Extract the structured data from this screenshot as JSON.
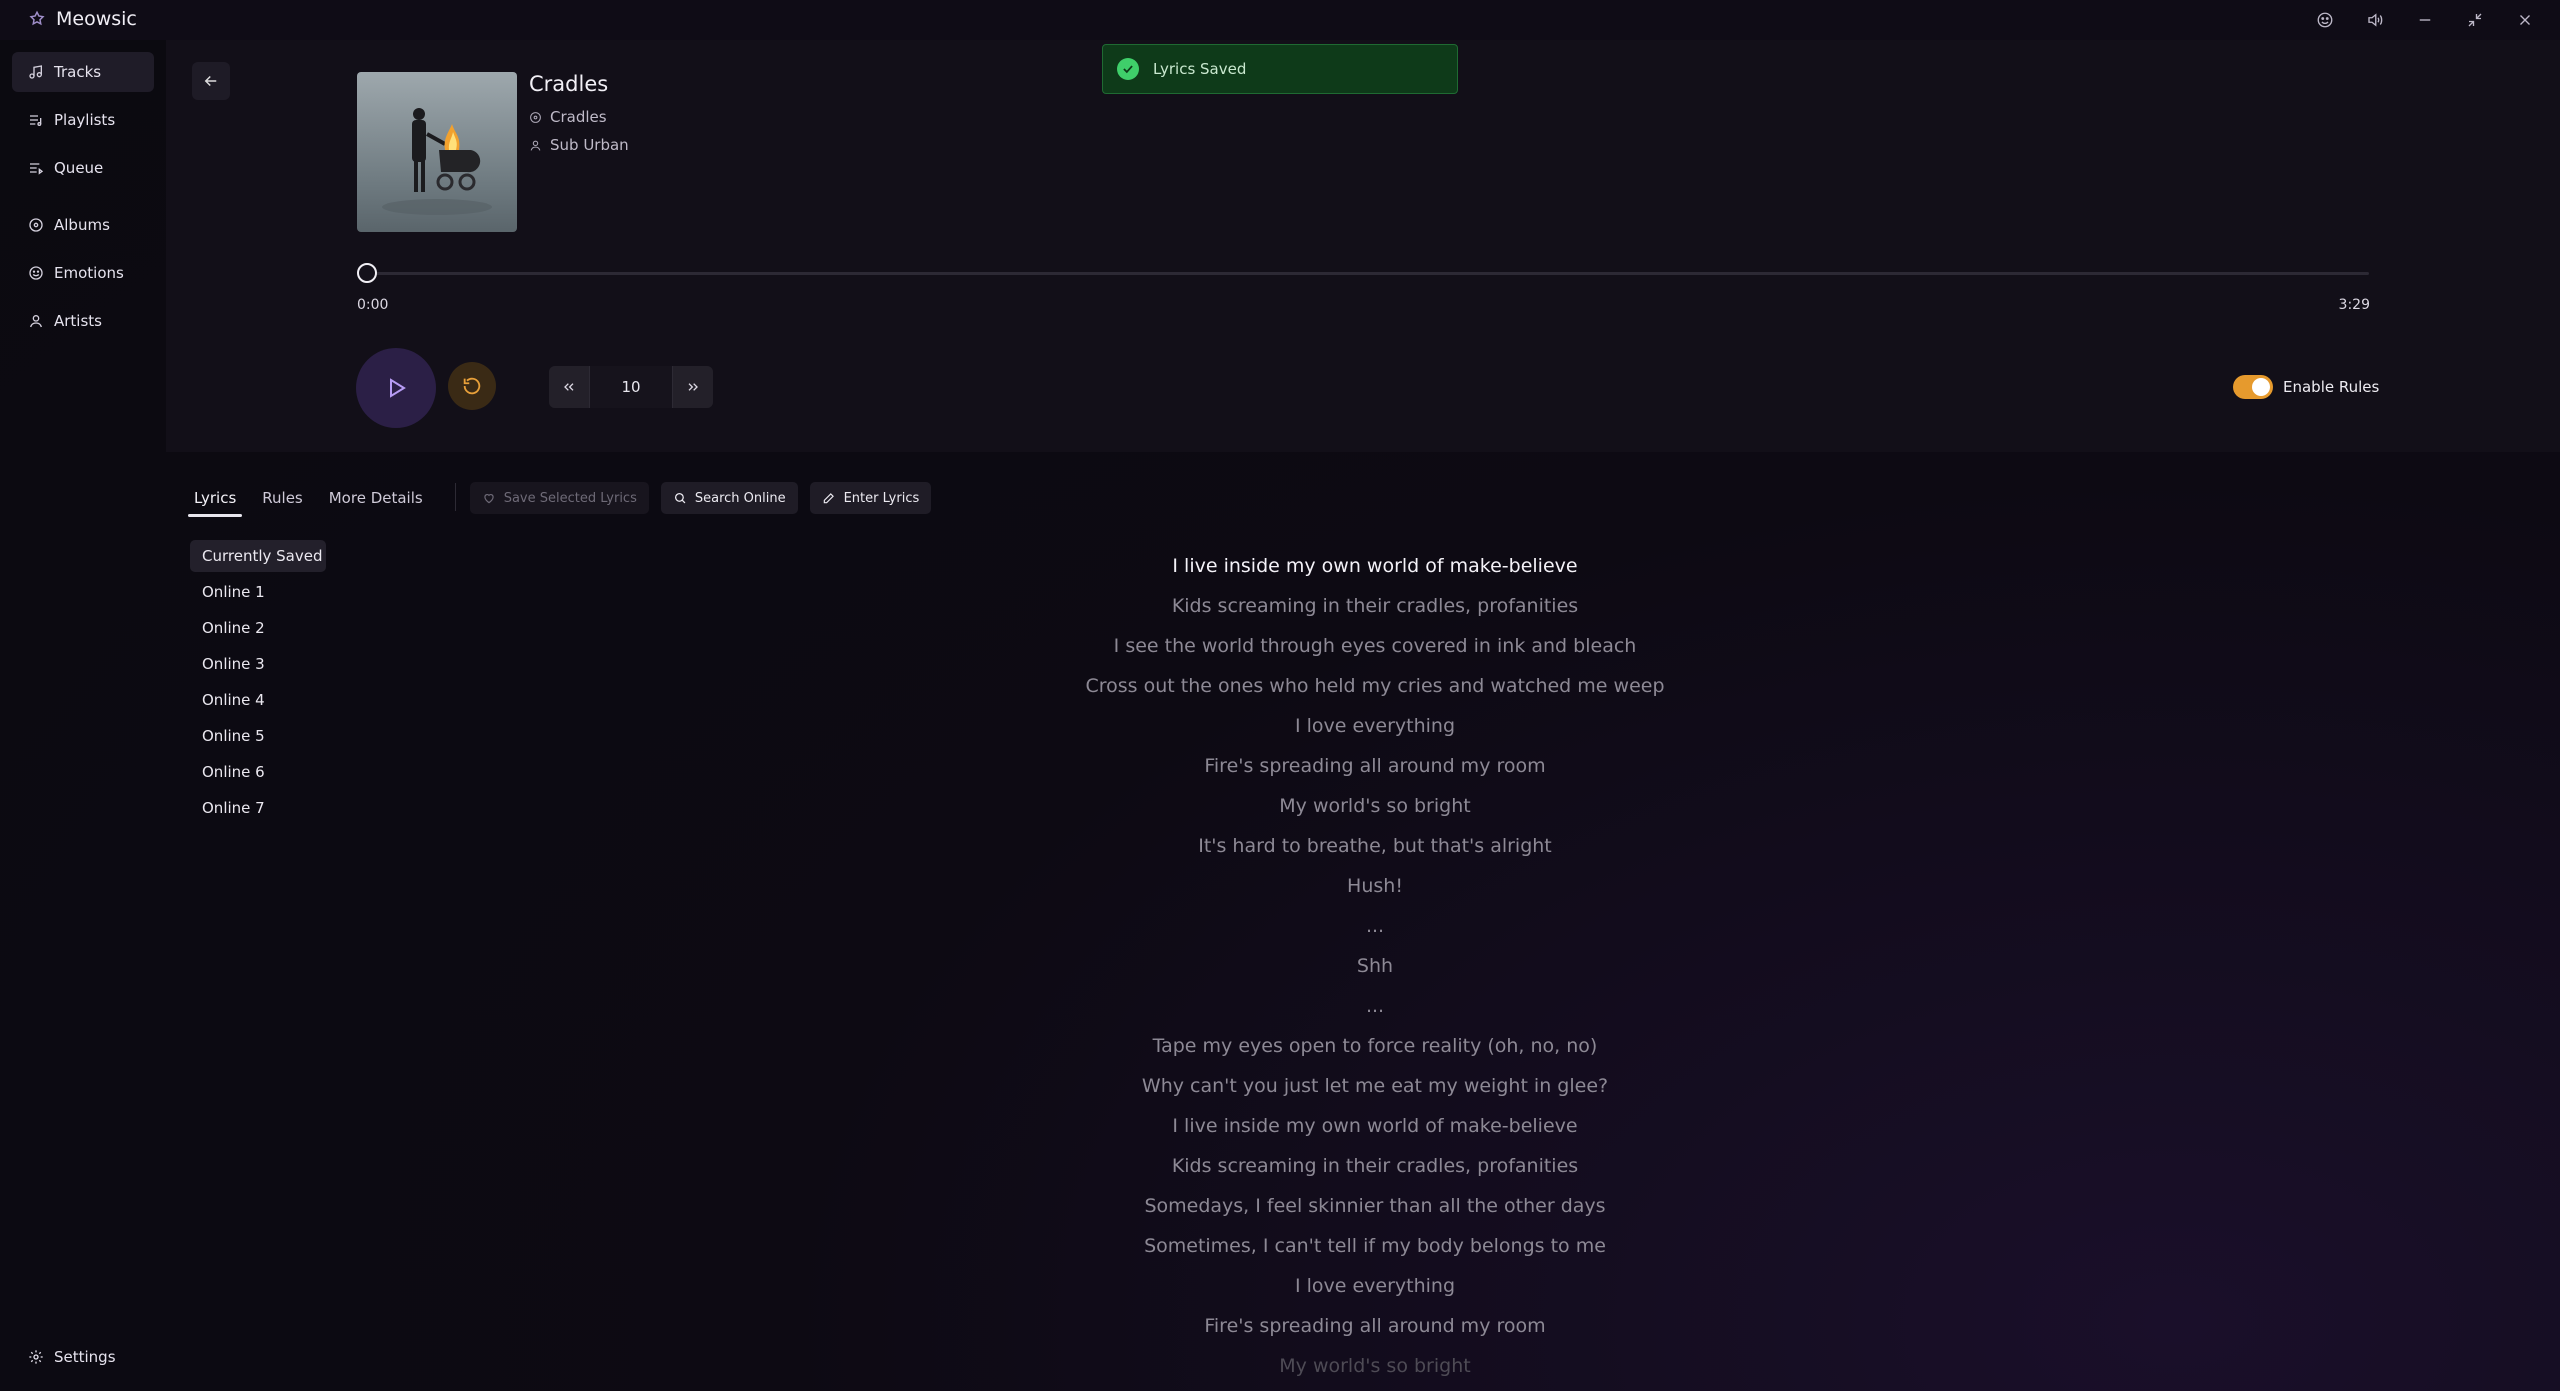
{
  "app": {
    "title": "Meowsic"
  },
  "window_controls": [
    "emoji-icon",
    "volume-icon",
    "minimize-icon",
    "restore-icon",
    "close-icon"
  ],
  "sidebar": {
    "items": [
      {
        "label": "Tracks",
        "icon": "music-note-icon",
        "active": true
      },
      {
        "label": "Playlists",
        "icon": "playlist-icon",
        "active": false
      },
      {
        "label": "Queue",
        "icon": "queue-icon",
        "active": false
      },
      {
        "label": "Albums",
        "icon": "disc-icon",
        "active": false
      },
      {
        "label": "Emotions",
        "icon": "smiley-icon",
        "active": false
      },
      {
        "label": "Artists",
        "icon": "user-icon",
        "active": false
      }
    ],
    "settings_label": "Settings"
  },
  "track": {
    "title": "Cradles",
    "album": "Cradles",
    "artist": "Sub Urban",
    "current_time": "0:00",
    "total_time": "3:29",
    "progress": 0
  },
  "controls": {
    "seek_seconds": "10",
    "enable_rules_label": "Enable Rules",
    "enable_rules_on": true
  },
  "toast": {
    "message": "Lyrics Saved"
  },
  "tabs": [
    {
      "label": "Lyrics",
      "active": true
    },
    {
      "label": "Rules",
      "active": false
    },
    {
      "label": "More Details",
      "active": false
    }
  ],
  "actions": {
    "save_selected": "Save Selected Lyrics",
    "search_online": "Search Online",
    "enter_lyrics": "Enter Lyrics"
  },
  "versions": [
    "Currently Saved",
    "Online 1",
    "Online 2",
    "Online 3",
    "Online 4",
    "Online 5",
    "Online 6",
    "Online 7"
  ],
  "lyrics": [
    "I live inside my own world of make-believe",
    "Kids screaming in their cradles, profanities",
    "I see the world through eyes covered in ink and bleach",
    "Cross out the ones who held my cries and watched me weep",
    "I love everything",
    "Fire's spreading all around my room",
    "My world's so bright",
    "It's hard to breathe, but that's alright",
    "Hush!",
    "...",
    "Shh",
    "...",
    "Tape my eyes open to force reality (oh, no, no)",
    "Why can't you just let me eat my weight in glee?",
    "I live inside my own world of make-believe",
    "Kids screaming in their cradles, profanities",
    "Somedays, I feel skinnier than all the other days",
    "Sometimes, I can't tell if my body belongs to me",
    "I love everything",
    "Fire's spreading all around my room",
    "My world's so bright"
  ]
}
